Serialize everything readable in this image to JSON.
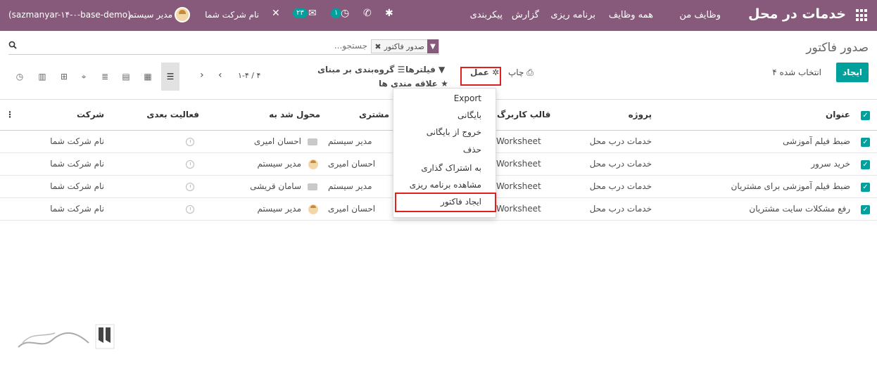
{
  "topbar": {
    "brand": "خدمات در محل",
    "menus": [
      "وظایف من",
      "همه وظایف",
      "برنامه ریزی",
      "گزارش",
      "پیکربندی"
    ],
    "company": "نام شرکت شما",
    "user": "مدیر سیستم",
    "db": "(sazmanyar-۱۴-۰-base-demo)",
    "badge_messages": "۲۳",
    "badge_activities": "۱"
  },
  "control": {
    "breadcrumb": "صدور فاکتور",
    "search_placeholder": "جستجو...",
    "facet_label": "صدور فاکتور",
    "create_label": "ایجاد",
    "selected_label": "۴ انتخاب شده",
    "print_label": "چاپ",
    "action_label": "عمل",
    "filters_label": "فیلترها",
    "groupby_label": "گروه‌بندی بر مبنای",
    "favorites_label": "علاقه مندی ها",
    "pager": "۱-۴ / ۴"
  },
  "table": {
    "headers": {
      "title": "عنوان",
      "project": "پروژه",
      "template": "قالب کاربرگ",
      "customer": "مشتری",
      "assigned": "محول شد به",
      "next_activity": "فعالیت بعدی",
      "company": "شرکت"
    },
    "rows": [
      {
        "title": "ضبط فیلم آموزشی",
        "project": "خدمات درب محل",
        "template": "Worksheet",
        "customer": "مدیر سیستم",
        "assigned": "احسان امیری",
        "company": "نام شرکت شما"
      },
      {
        "title": "خرید سرور",
        "project": "خدمات درب محل",
        "template": "Worksheet",
        "customer": "احسان امیری",
        "assigned": "مدیر سیستم",
        "company": "نام شرکت شما"
      },
      {
        "title": "ضبط فیلم آموزشی برای مشتریان",
        "project": "خدمات درب محل",
        "template": "Worksheet",
        "customer": "مدیر سیستم",
        "assigned": "سامان قریشی",
        "company": "نام شرکت شما"
      },
      {
        "title": "رفع مشکلات سایت مشتریان",
        "project": "خدمات درب محل",
        "template": "Worksheet",
        "customer": "احسان امیری",
        "assigned": "مدیر سیستم",
        "company": "نام شرکت شما"
      }
    ]
  },
  "action_menu": {
    "items": [
      "Export",
      "بایگانی",
      "خروج از بایگانی",
      "حذف",
      "به اشتراک گذاری",
      "مشاهده برنامه ریزی",
      "ایجاد فاکتور"
    ]
  },
  "colors": {
    "brand": "#875a7b",
    "primary": "#00a09d",
    "highlight": "#e02020"
  }
}
